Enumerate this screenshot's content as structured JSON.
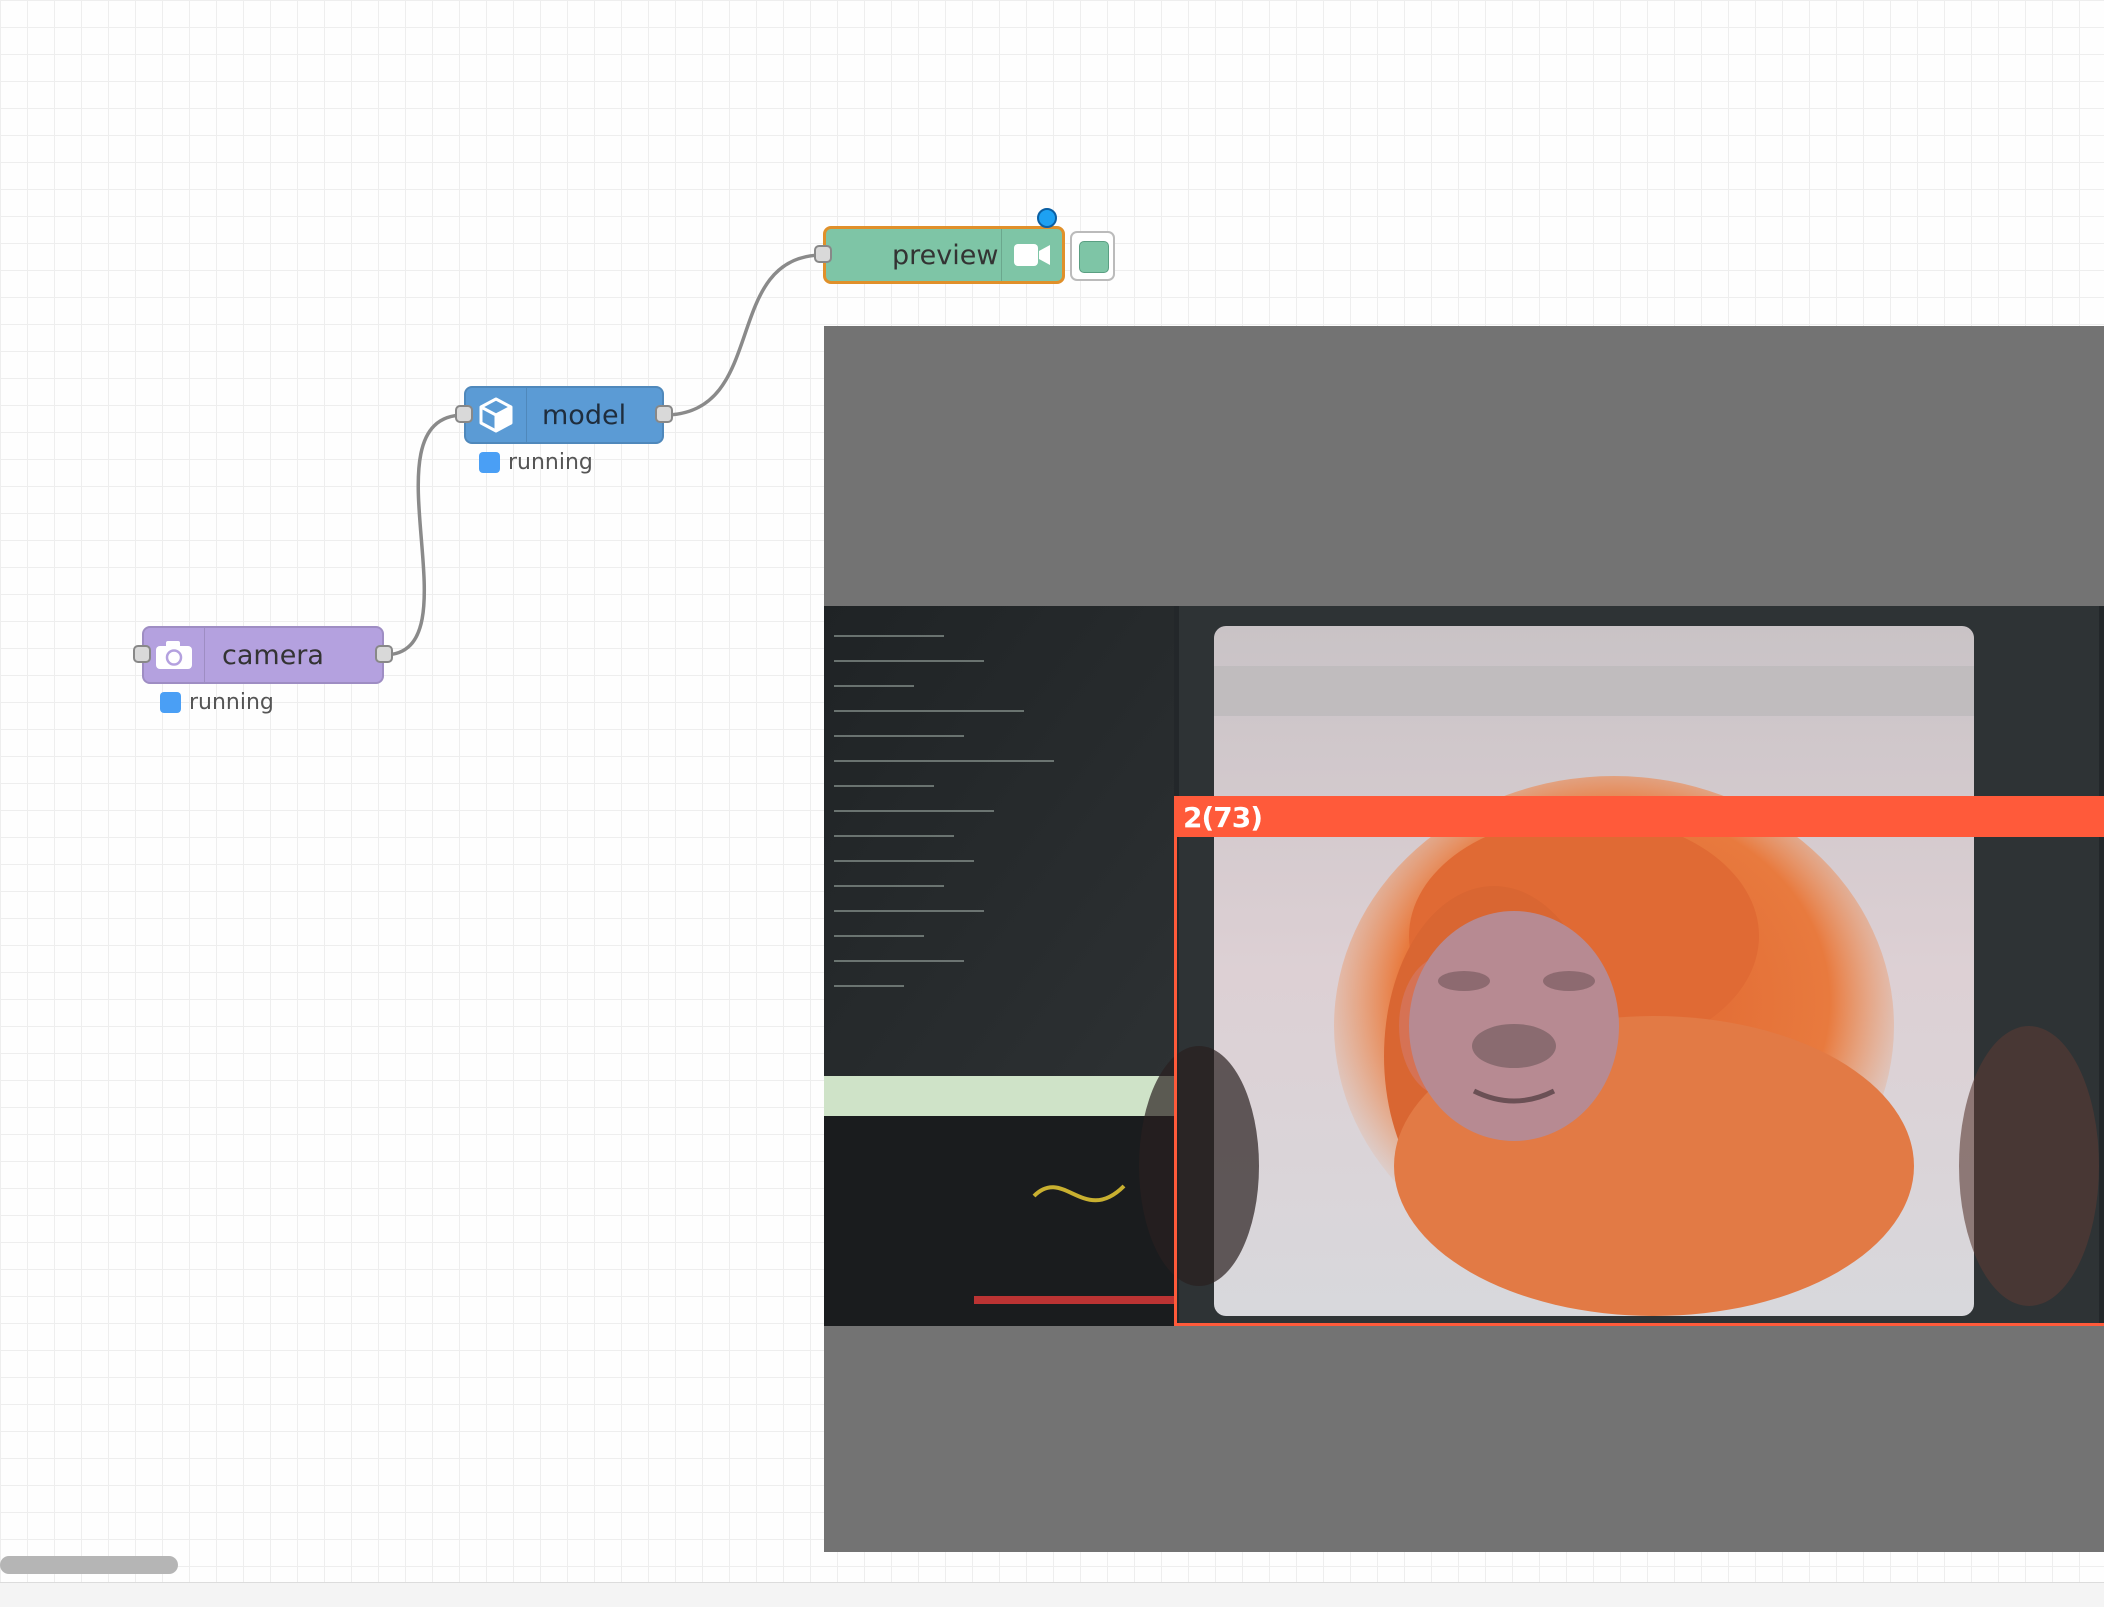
{
  "flow": {
    "nodes": {
      "camera": {
        "label": "camera",
        "status": "running",
        "icon": "camera-icon",
        "color": "#b4a1df"
      },
      "model": {
        "label": "model",
        "status": "running",
        "icon": "cube-icon",
        "color": "#5b9bd5"
      },
      "preview": {
        "label": "preview",
        "icon": "video-camera-icon",
        "color": "#7ec5a6",
        "selected_border": "#e0902a"
      }
    },
    "status_color": "#4a9ff5",
    "changed_indicator_color": "#1da1f2"
  },
  "preview_panel": {
    "detection": {
      "label": "2(73)",
      "color": "#ff5a3a"
    }
  }
}
